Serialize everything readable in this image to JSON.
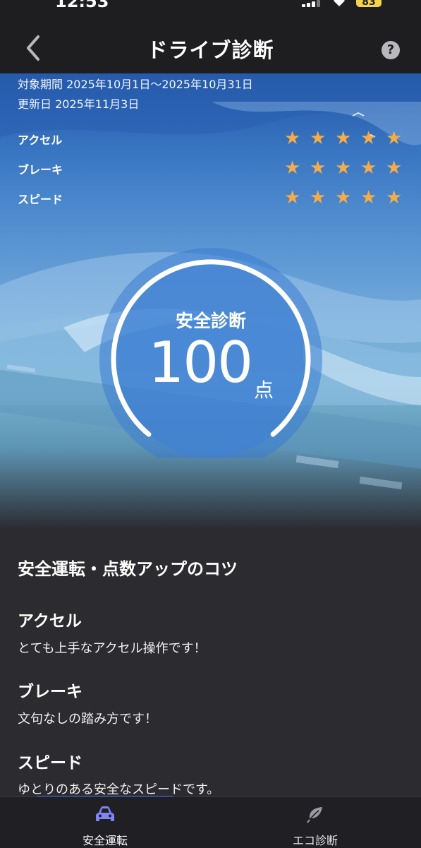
{
  "status_bar": {
    "time": "12:53",
    "battery": "83"
  },
  "header": {
    "title": "ドライブ診断",
    "help_label": "?"
  },
  "summary": {
    "period": "対象期間 2025年10月1日〜2025年10月31日",
    "updated": "更新日 2025年11月3日"
  },
  "ratings": [
    {
      "label": "アクセル",
      "stars": 5,
      "max_stars": 5
    },
    {
      "label": "ブレーキ",
      "stars": 5,
      "max_stars": 5
    },
    {
      "label": "スピード",
      "stars": 5,
      "max_stars": 5
    }
  ],
  "score": {
    "label": "安全診断",
    "value": "100",
    "unit": "点"
  },
  "tips": {
    "title": "安全運転・点数アップのコツ",
    "items": [
      {
        "heading": "アクセル",
        "text": "とても上手なアクセル操作です！"
      },
      {
        "heading": "ブレーキ",
        "text": "文句なしの踏み方です！"
      },
      {
        "heading": "スピード",
        "text": "ゆとりのある安全なスピードです。"
      }
    ]
  },
  "bottom_nav": {
    "items": [
      {
        "label": "安全運転",
        "icon": "car-icon",
        "active": true
      },
      {
        "label": "エコ診断",
        "icon": "leaf-icon",
        "active": false
      }
    ]
  },
  "colors": {
    "star": "#f5ac48",
    "active_nav": "#7f86f4",
    "accent_underline": "#3c64e0",
    "background": "#2b2b30"
  }
}
